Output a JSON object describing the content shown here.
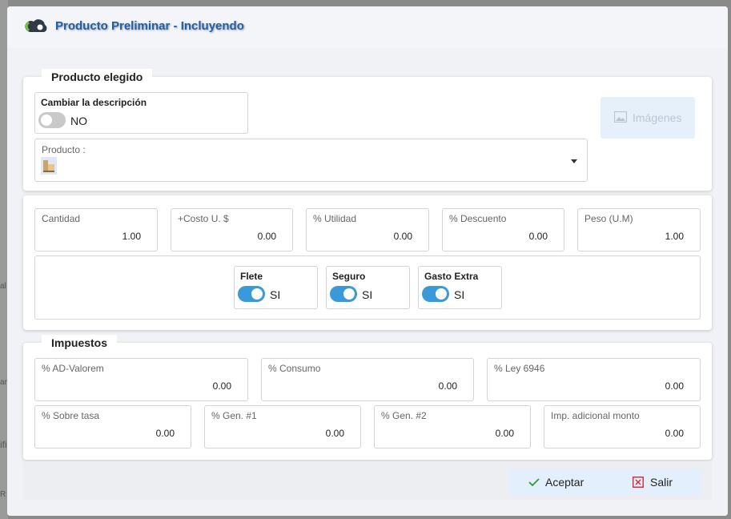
{
  "backdrop": {
    "frag1": "al",
    "frag2": "ar",
    "frag3": "ifi",
    "frag4": "R"
  },
  "header": {
    "title": "Producto Preliminar - Incluyendo"
  },
  "producto_section": {
    "legend": "Producto elegido",
    "cambiar_descripcion": {
      "label": "Cambiar la descripción",
      "state": "NO"
    },
    "producto_select": {
      "label": "Producto :",
      "value": ""
    },
    "imagenes_button": "Imágenes"
  },
  "cantidades": {
    "cantidad": {
      "label": "Cantidad",
      "value": "1.00"
    },
    "costo": {
      "label": "+Costo U. $",
      "value": "0.00"
    },
    "utilidad": {
      "label": "% Utilidad",
      "value": "0.00"
    },
    "descuento": {
      "label": "% Descuento",
      "value": "0.00"
    },
    "peso": {
      "label": "Peso (U.M)",
      "value": "1.00"
    }
  },
  "toggles": {
    "flete": {
      "label": "Flete",
      "state": "SI"
    },
    "seguro": {
      "label": "Seguro",
      "state": "SI"
    },
    "gasto_extra": {
      "label": "Gasto Extra",
      "state": "SI"
    }
  },
  "impuestos": {
    "legend": "Impuestos",
    "ad_valorem": {
      "label": "% AD-Valorem",
      "value": "0.00"
    },
    "consumo": {
      "label": "% Consumo",
      "value": "0.00"
    },
    "ley_6946": {
      "label": "% Ley 6946",
      "value": "0.00"
    },
    "sobre_tasa": {
      "label": "% Sobre tasa",
      "value": "0.00"
    },
    "gen1": {
      "label": "% Gen. #1",
      "value": "0.00"
    },
    "gen2": {
      "label": "% Gen. #2",
      "value": "0.00"
    },
    "imp_adicional": {
      "label": "Imp. adicional monto",
      "value": "0.00"
    }
  },
  "footer": {
    "aceptar": "Aceptar",
    "salir": "Salir"
  },
  "icons": {
    "logo": "cloud-logo-icon",
    "product_thumb": "product-thumbnail-icon",
    "image": "image-icon",
    "check": "check-icon",
    "close": "close-box-icon",
    "dropdown": "chevron-down-icon"
  },
  "colors": {
    "title": "#1f5fa8",
    "toggle_on": "#3a9ad9",
    "toggle_off": "#c9c9c9",
    "close_red": "#d9262e",
    "check_green": "#2e9b3a"
  }
}
